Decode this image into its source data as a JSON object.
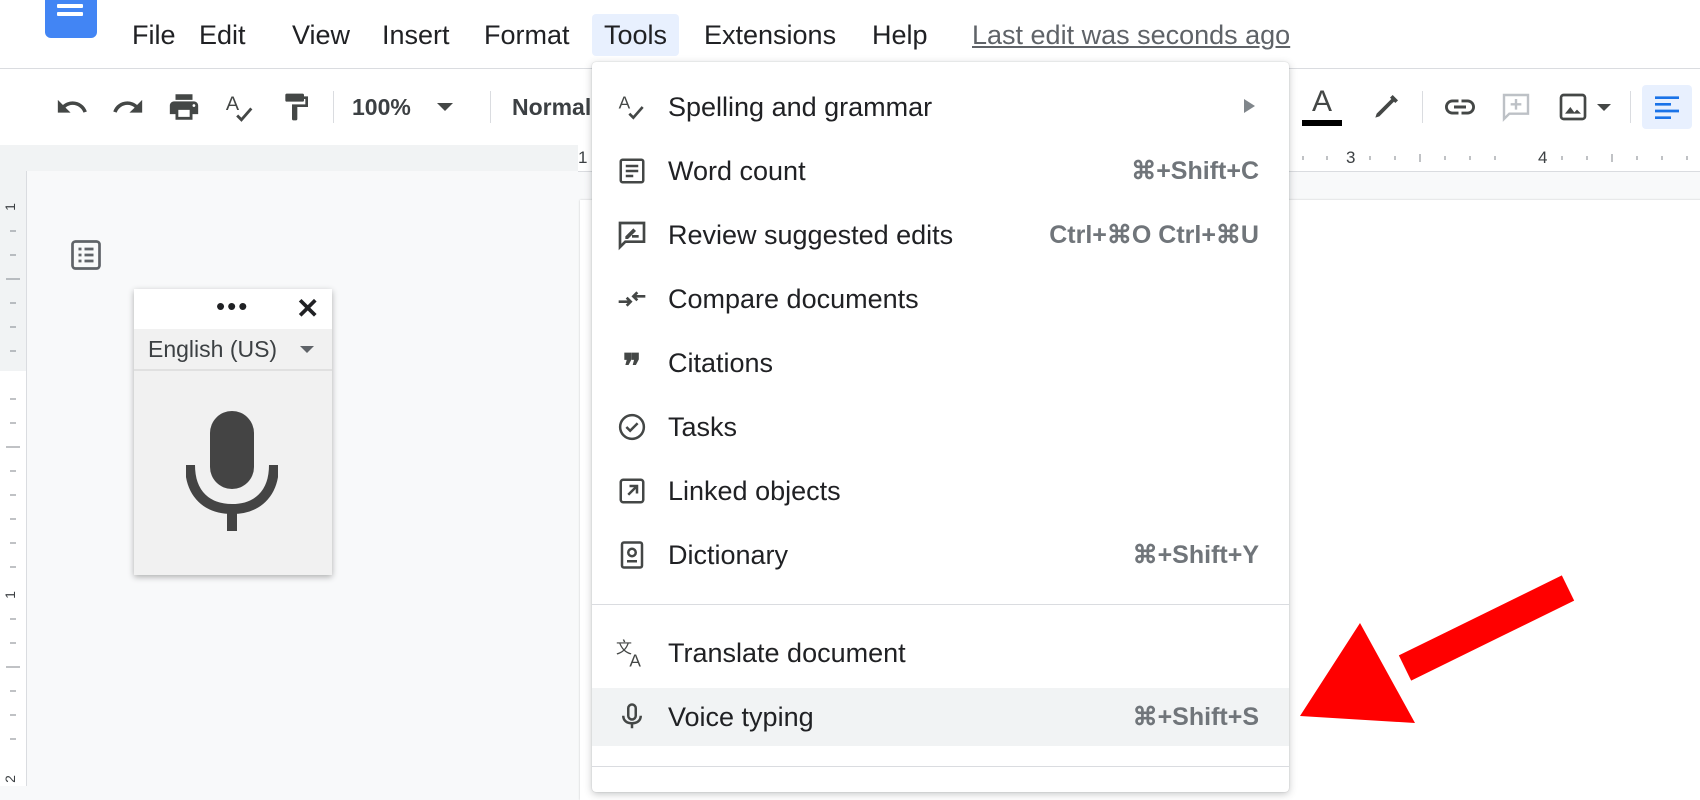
{
  "menubar": {
    "items": [
      {
        "label": "File"
      },
      {
        "label": "Edit"
      },
      {
        "label": "View"
      },
      {
        "label": "Insert"
      },
      {
        "label": "Format"
      },
      {
        "label": "Tools"
      },
      {
        "label": "Extensions"
      },
      {
        "label": "Help"
      }
    ],
    "active_item": "Tools",
    "last_edit": "Last edit was seconds ago"
  },
  "toolbar": {
    "zoom": "100%",
    "style": "Normal"
  },
  "ruler": {
    "marks": [
      "1",
      "3",
      "4"
    ],
    "vertical_marks": [
      "1",
      "1",
      "2"
    ]
  },
  "voice_widget": {
    "dots": "•••",
    "close": "✕",
    "language": "English (US)"
  },
  "tools_menu": {
    "items": [
      {
        "icon": "spelling-icon",
        "label": "Spelling and grammar",
        "shortcut": "",
        "submenu": true
      },
      {
        "icon": "word-count-icon",
        "label": "Word count",
        "shortcut": "⌘+Shift+C"
      },
      {
        "icon": "review-edits-icon",
        "label": "Review suggested edits",
        "shortcut": "Ctrl+⌘O Ctrl+⌘U"
      },
      {
        "icon": "compare-icon",
        "label": "Compare documents",
        "shortcut": ""
      },
      {
        "icon": "citations-icon",
        "label": "Citations",
        "shortcut": ""
      },
      {
        "icon": "tasks-icon",
        "label": "Tasks",
        "shortcut": ""
      },
      {
        "icon": "linked-objects-icon",
        "label": "Linked objects",
        "shortcut": ""
      },
      {
        "icon": "dictionary-icon",
        "label": "Dictionary",
        "shortcut": "⌘+Shift+Y"
      },
      {
        "icon": "translate-icon",
        "label": "Translate document",
        "shortcut": ""
      },
      {
        "icon": "microphone-icon",
        "label": "Voice typing",
        "shortcut": "⌘+Shift+S",
        "highlighted": true
      }
    ]
  },
  "colors": {
    "accent": "#1a73e8",
    "menu_active_bg": "#e8f0fe",
    "hover_bg": "#f1f3f4",
    "annotation_arrow": "#ff0000"
  }
}
